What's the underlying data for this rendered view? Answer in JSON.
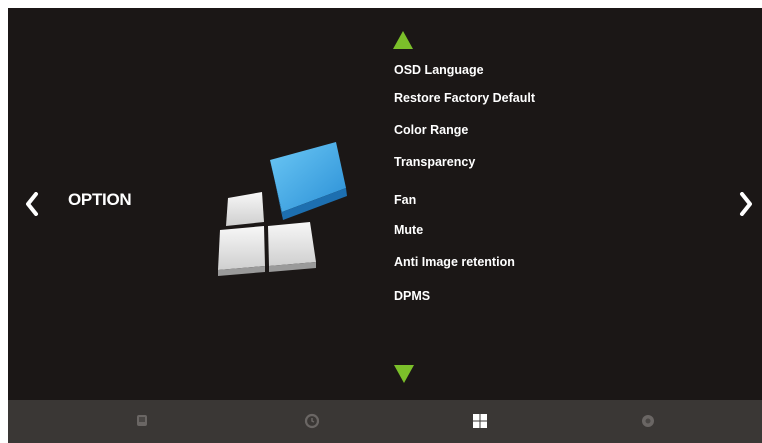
{
  "header": {
    "section_title": "OPTION"
  },
  "icons": {
    "prev": "chevron-left-icon",
    "next": "chevron-right-icon",
    "scroll_up": "triangle-up-icon",
    "scroll_down": "triangle-down-icon",
    "graphic": "option-tiles-graphic"
  },
  "menu": {
    "items": [
      {
        "label": "OSD Language"
      },
      {
        "label": "Restore Factory Default"
      },
      {
        "label": "Color Range"
      },
      {
        "label": "Transparency"
      },
      {
        "label": "Fan"
      },
      {
        "label": "Mute"
      },
      {
        "label": "Anti Image retention"
      },
      {
        "label": "DPMS"
      }
    ]
  },
  "bottom_bar": {
    "tabs": [
      {
        "icon": "picture-icon",
        "active": false
      },
      {
        "icon": "clock-icon",
        "active": false
      },
      {
        "icon": "grid-icon",
        "active": true
      },
      {
        "icon": "gear-icon",
        "active": false
      }
    ]
  },
  "colors": {
    "background": "#1b1716",
    "accent_green": "#7bbf2a",
    "tile_blue": "#3aa8e8",
    "bottom_bar": "#3a3735",
    "text": "#ffffff"
  }
}
